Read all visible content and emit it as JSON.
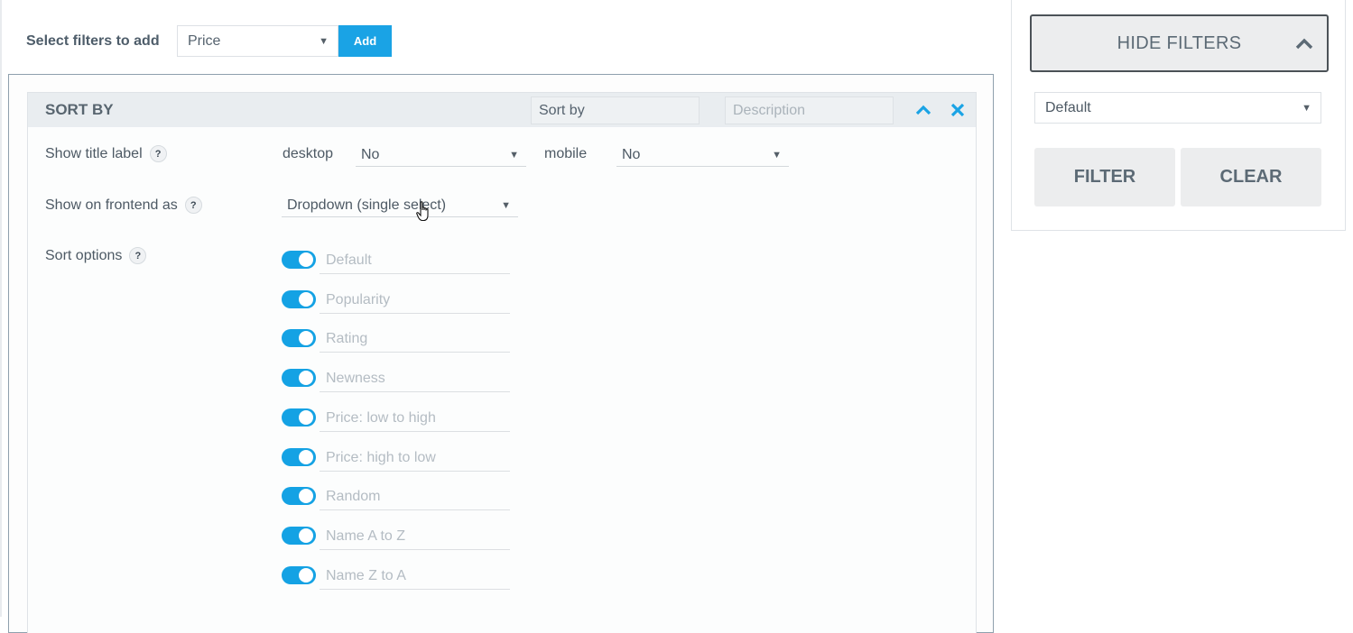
{
  "add_filter": {
    "label": "Select filters to add",
    "selected": "Price",
    "button": "Add"
  },
  "card": {
    "title": "SORT BY",
    "name_value": "Sort by",
    "description_placeholder": "Description",
    "show_title_label": "Show title label",
    "desktop_label": "desktop",
    "desktop_value": "No",
    "mobile_label": "mobile",
    "mobile_value": "No",
    "show_frontend_label": "Show on frontend as",
    "frontend_value": "Dropdown (single select)",
    "sort_options_label": "Sort options",
    "help": "?",
    "options": [
      {
        "label": "Default",
        "enabled": true
      },
      {
        "label": "Popularity",
        "enabled": true
      },
      {
        "label": "Rating",
        "enabled": true
      },
      {
        "label": "Newness",
        "enabled": true
      },
      {
        "label": "Price: low to high",
        "enabled": true
      },
      {
        "label": "Price: high to low",
        "enabled": true
      },
      {
        "label": "Random",
        "enabled": true
      },
      {
        "label": "Name A to Z",
        "enabled": true
      },
      {
        "label": "Name Z to A",
        "enabled": true
      }
    ]
  },
  "sidebar": {
    "hide_filters": "HIDE FILTERS",
    "sort_select": "Default",
    "filter_button": "FILTER",
    "clear_button": "CLEAR"
  },
  "colors": {
    "accent": "#1aa3e5",
    "panel_border": "#8fa0ad",
    "button_bg": "#ecedee"
  }
}
